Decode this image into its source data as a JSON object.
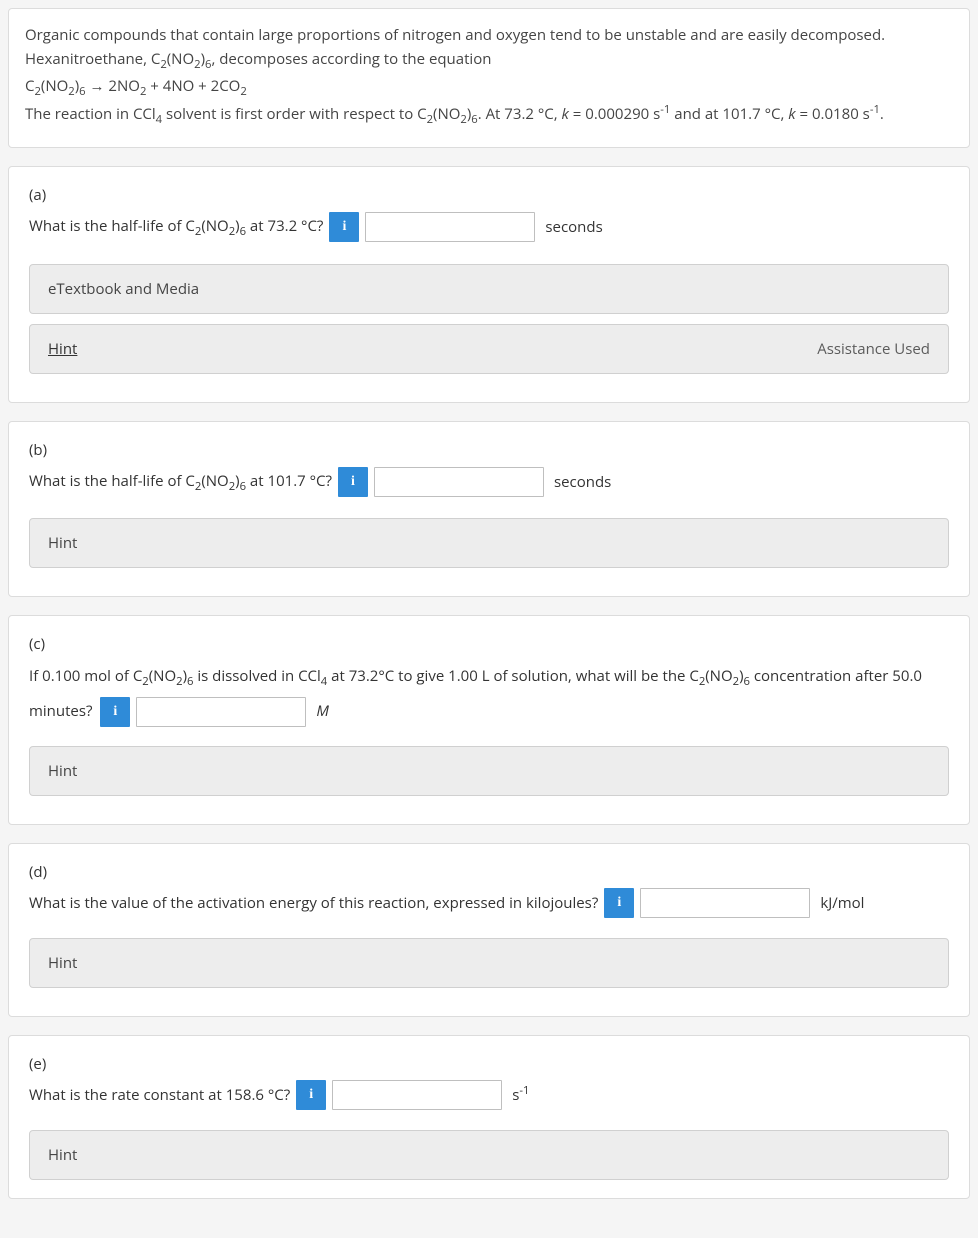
{
  "intro": {
    "line1_a": "Organic compounds that contain large proportions of nitrogen and oxygen tend to be unstable and are easily decomposed. Hexanitroethane, C",
    "line1_b": "(NO",
    "line1_c": ")",
    "line1_d": ", decomposes according to the equation",
    "eq_a": "C",
    "eq_b": "(NO",
    "eq_c": ")",
    "eq_d": " → 2NO",
    "eq_e": " + 4NO + 2CO",
    "line3_a": "The reaction in CCl",
    "line3_b": " solvent is first order with respect to C",
    "line3_c": "(NO",
    "line3_d": ")",
    "line3_e": ". At 73.2 °C, ",
    "k1": "k",
    "line3_f": " = 0.000290 s",
    "line3_g": " and at 101.7 °C, ",
    "k2": "k",
    "line3_h": " = 0.0180 s",
    "period": "."
  },
  "parts": {
    "a": {
      "label": "(a)",
      "q1": "What is the half-life of C",
      "q2": "(NO",
      "q3": ")",
      "q4": " at 73.2 °C?",
      "unit": "seconds",
      "etext": "eTextbook and Media",
      "hint": "Hint",
      "assist": "Assistance Used"
    },
    "b": {
      "label": "(b)",
      "q1": "What is the half-life of C",
      "q2": "(NO",
      "q3": ")",
      "q4": " at 101.7 °C?",
      "unit": "seconds",
      "hint": "Hint"
    },
    "c": {
      "label": "(c)",
      "q1": "If 0.100 mol of C",
      "q2": "(NO",
      "q3": ")",
      "q4": " is dissolved in CCl",
      "q5": " at 73.2°C to give 1.00 L of solution, what will be the C",
      "q6": "(NO",
      "q7": ")",
      "q8": " concentration after 50.0 minutes?",
      "unit": "M",
      "hint": "Hint"
    },
    "d": {
      "label": "(d)",
      "q": "What is the value of the activation energy of this reaction, expressed in kilojoules?",
      "unit": "kJ/mol",
      "hint": "Hint"
    },
    "e": {
      "label": "(e)",
      "q": "What is the rate constant at 158.6 °C?",
      "unit_a": "s",
      "hint": "Hint"
    }
  },
  "info_glyph": "i",
  "sub2": "2",
  "sub4": "4",
  "sub6": "6",
  "supm1": "-1"
}
